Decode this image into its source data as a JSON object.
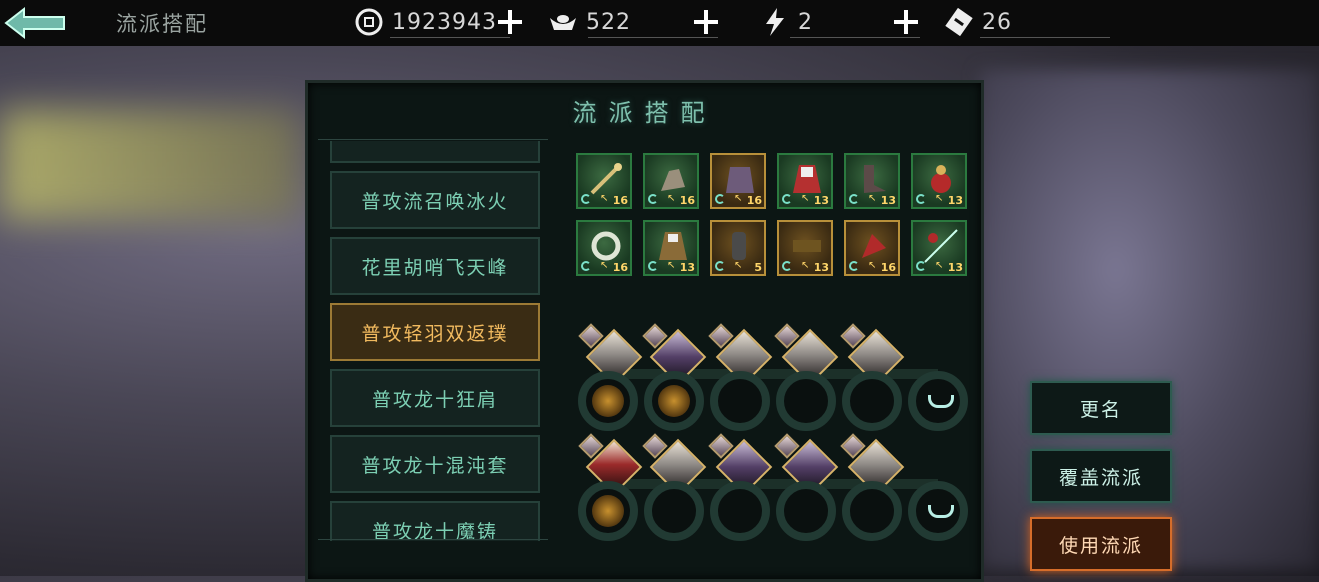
{
  "header": {
    "title": "流派搭配",
    "coins": "1923943",
    "ingots": "522",
    "energy": "2",
    "tickets": "26"
  },
  "panel": {
    "title": "流派搭配",
    "list": [
      {
        "label": "普攻流召唤冰火",
        "active": false
      },
      {
        "label": "花里胡哨飞天峰",
        "active": false
      },
      {
        "label": "普攻轻羽双返璞",
        "active": true
      },
      {
        "label": "普攻龙十狂肩",
        "active": false
      },
      {
        "label": "普攻龙十混沌套",
        "active": false
      },
      {
        "label": "普攻龙十魔铸",
        "active": false
      }
    ],
    "equipment": [
      {
        "lv": "16"
      },
      {
        "lv": "16"
      },
      {
        "lv": "16"
      },
      {
        "lv": "13"
      },
      {
        "lv": "13"
      },
      {
        "lv": "13"
      },
      {
        "lv": "16"
      },
      {
        "lv": "13"
      },
      {
        "lv": "5"
      },
      {
        "lv": "13"
      },
      {
        "lv": "16"
      },
      {
        "lv": "13"
      }
    ]
  },
  "actions": {
    "rename": "更名",
    "overwrite": "覆盖流派",
    "use": "使用流派"
  },
  "colors": {
    "accent_green": "#7ccfb3",
    "active_gold": "#f1ba5f",
    "primary_orange": "#d66d2a"
  }
}
